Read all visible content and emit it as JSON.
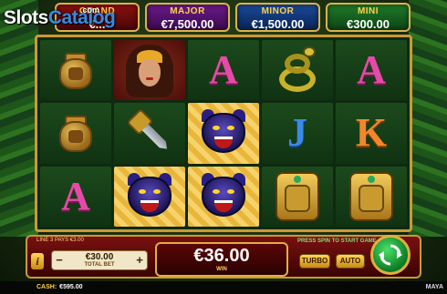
{
  "watermark": {
    "brand": "Slots",
    "brand2": "Catalog",
    "sub": ".com"
  },
  "jackpots": {
    "grand": {
      "title": "GRAND",
      "value": "€..."
    },
    "major": {
      "title": "MAJOR",
      "value": "€7,500.00"
    },
    "minor": {
      "title": "MINOR",
      "value": "€1,500.00"
    },
    "mini": {
      "title": "MINI",
      "value": "€300.00"
    }
  },
  "reels": [
    [
      "pot",
      "pot",
      "A"
    ],
    [
      "queen",
      "dagger",
      "panther"
    ],
    [
      "A",
      "panther",
      "panther"
    ],
    [
      "snake",
      "J",
      "mask"
    ],
    [
      "A",
      "K",
      "mask"
    ]
  ],
  "panel": {
    "line_text": "LINE 3 PAYS €3.00",
    "info_label": "i",
    "bet_minus": "−",
    "bet_plus": "+",
    "bet_amount": "€30.00",
    "bet_label": "TOTAL BET",
    "win_amount": "€36.00",
    "win_label": "WIN",
    "press_text": "PRESS SPIN TO START GAME",
    "turbo_label": "TURBO",
    "auto_label": "AUTO"
  },
  "footer": {
    "cash_label": "CASH:",
    "cash_value": "€595.00",
    "tag": "MAYA"
  }
}
